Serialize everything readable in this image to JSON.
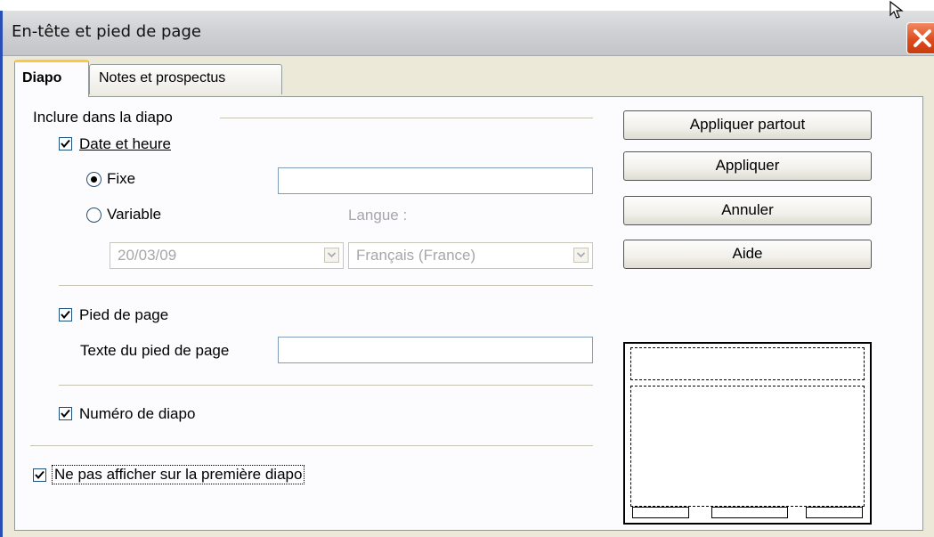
{
  "window": {
    "title": "En-tête et pied de page"
  },
  "tabs": [
    {
      "label": "Diapo",
      "active": true
    },
    {
      "label": "Notes et prospectus",
      "active": false
    }
  ],
  "include_group": {
    "label": "Inclure dans la diapo"
  },
  "date_time": {
    "label": "Date et heure",
    "checked": true,
    "fixed_label": "Fixe",
    "fixed_value": "",
    "variable_label": "Variable",
    "language_label": "Langue :",
    "date_format": "20/03/09",
    "language_value": "Français (France)"
  },
  "footer": {
    "label": "Pied de page",
    "checked": true,
    "text_label": "Texte du pied de page",
    "text_value": ""
  },
  "slide_number": {
    "label": "Numéro de diapo",
    "checked": true
  },
  "not_first": {
    "label": "Ne pas afficher sur la première diapo",
    "checked": true
  },
  "buttons": {
    "apply_all": "Appliquer partout",
    "apply": "Appliquer",
    "cancel": "Annuler",
    "help": "Aide"
  },
  "colors": {
    "title_bar": "#cfd1d4",
    "dialog": "#ece9d8",
    "close": "#dd4c1d",
    "tab_accent": "#ffc83c"
  }
}
